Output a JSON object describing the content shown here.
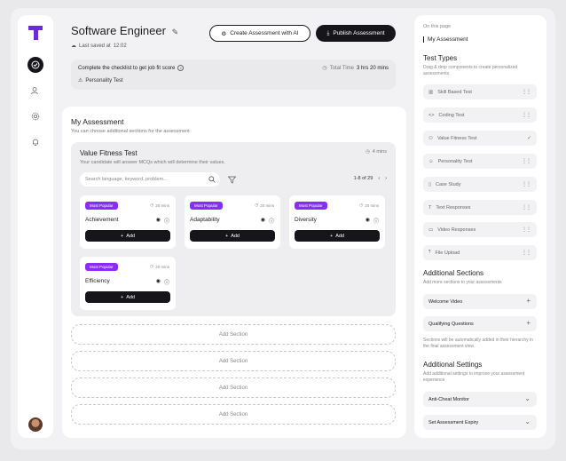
{
  "header": {
    "title": "Software Engineer",
    "saved": "Last saved at",
    "saved_time": "12:02",
    "create_ai": "Create Assessment with AI",
    "publish": "Publish Assessment"
  },
  "checklist": {
    "text": "Complete the checklist to get job fit score",
    "item": "Personality Test",
    "total_label": "Total Time",
    "total_value": "3 hrs 20 mins"
  },
  "assessment": {
    "title": "My Assessment",
    "subtitle": "You can choose additional sections for the assessment",
    "section": {
      "title": "Value Fitness Test",
      "subtitle": "Your candidate will answer MCQs which will determine their values.",
      "time": "4 mins",
      "search_placeholder": "Search language, keyword, problem...",
      "pager": "1-8 of 29"
    },
    "cards": [
      {
        "badge": "Most Popular",
        "time": "20 mins",
        "name": "Achievement",
        "add": "Add"
      },
      {
        "badge": "Most Popular",
        "time": "20 mins",
        "name": "Adaptability",
        "add": "Add"
      },
      {
        "badge": "Most Popular",
        "time": "20 mins",
        "name": "Diversity",
        "add": "Add"
      },
      {
        "badge": "Most Popular",
        "time": "20 mins",
        "name": "Efficiency",
        "add": "Add"
      }
    ],
    "add_section": [
      "Add Section",
      "Add Section",
      "Add Section",
      "Add Section"
    ]
  },
  "sidebar": {
    "on_page": "On this page",
    "on_page_item": "My Assessment",
    "test_types_title": "Test Types",
    "test_types_sub": "Drag & drop components to create personalized assessments",
    "test_types": [
      "Skill Based Test",
      "Coding Test",
      "Value Fitness Test",
      "Personality Test",
      "Case Study",
      "Text Responses",
      "Video Responses",
      "File Upload"
    ],
    "additional_sections_title": "Additional Sections",
    "additional_sections_sub": "Add more sections to your assessments",
    "additional_sections": [
      "Welcome Video",
      "Qualifying Questions"
    ],
    "sections_note": "Sections will be automatically added in their hierarchy in the final assessment view.",
    "additional_settings_title": "Additional Settings",
    "additional_settings_sub": "Add additional settings to improve your assessment experience",
    "additional_settings": [
      "Anti-Cheat Monitor",
      "Set Assessment Expiry"
    ]
  },
  "colors": {
    "accent": "#8b2cf5",
    "dark": "#16161a"
  }
}
